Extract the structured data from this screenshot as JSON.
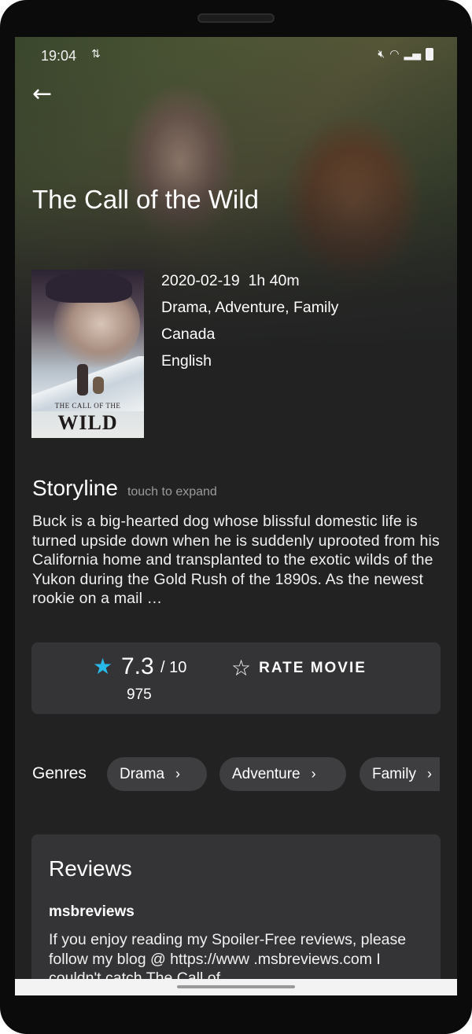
{
  "status_bar": {
    "time": "19:04",
    "sync_icon": "data-sync-icon",
    "icons": [
      "mute-icon",
      "wifi-icon",
      "signal-icon",
      "battery-icon"
    ]
  },
  "header": {
    "back_icon": "arrow-left-icon",
    "title": "The Call of the Wild"
  },
  "poster": {
    "title_small": "THE CALL OF THE",
    "title_big": "WILD"
  },
  "meta": {
    "release": "2020-02-19  1h 40m",
    "genres_line": "Drama, Adventure, Family",
    "country": "Canada",
    "language": "English"
  },
  "storyline": {
    "title": "Storyline",
    "hint": "touch to expand",
    "text": "Buck is a big-hearted dog whose blissful domestic life is turned upside down when he is suddenly uprooted from his California home and transplanted to the exotic wilds of the Yukon during the Gold Rush of the 1890s. As the newest rookie on a mail …"
  },
  "rating": {
    "value": "7.3",
    "scale": "/ 10",
    "votes": "975",
    "star_color": "#27b9e8",
    "rate_label": "RATE MOVIE"
  },
  "genres": {
    "label": "Genres",
    "chips": [
      "Drama",
      "Adventure",
      "Family"
    ]
  },
  "reviews": {
    "title": "Reviews",
    "items": [
      {
        "author": "msbreviews",
        "text": "If you enjoy reading my Spoiler-Free reviews, please follow my blog @ https://www .msbreviews.com I couldn't catch The Call of"
      }
    ]
  },
  "colors": {
    "background": "#222223",
    "card": "#343436",
    "chip": "#3e3e40",
    "accent": "#27b9e8"
  }
}
